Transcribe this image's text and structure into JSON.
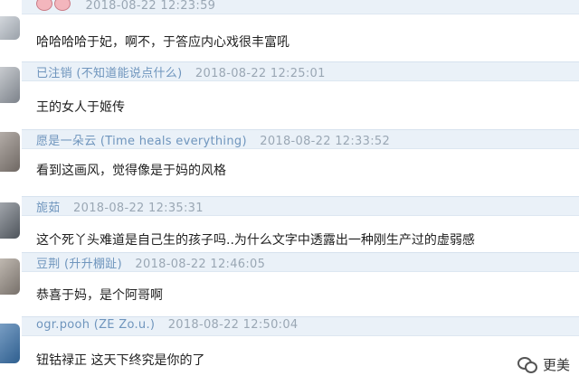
{
  "comments": [
    {
      "name": "",
      "time": "2018-08-22 12:23:59",
      "text": "哈哈哈哈于妃，啊不，于答应内心戏很丰富吼"
    },
    {
      "name": "已注销 (不知道能说点什么)",
      "time": "2018-08-22 12:25:01",
      "text": "王的女人于姬传"
    },
    {
      "name": "愿是一朵云 (Time heals everything)",
      "time": "2018-08-22 12:33:52",
      "text": "看到这画风，觉得像是于妈的风格"
    },
    {
      "name": "旎茹",
      "time": "2018-08-22 12:35:31",
      "text": "这个死丫头难道是自己生的孩子吗..为什么文字中透露出一种刚生产过的虚弱感"
    },
    {
      "name": "豆荆 (升升棚趾)",
      "time": "2018-08-22 12:46:05",
      "text": "恭喜于妈，是个阿哥啊"
    },
    {
      "name": "ogr.pooh (ZE Zo.u.)",
      "time": "2018-08-22 12:50:04",
      "text": "钮钴禄正 这天下终究是你的了"
    }
  ],
  "watermark": {
    "label": "更美",
    "icon": "wechat-icon"
  }
}
